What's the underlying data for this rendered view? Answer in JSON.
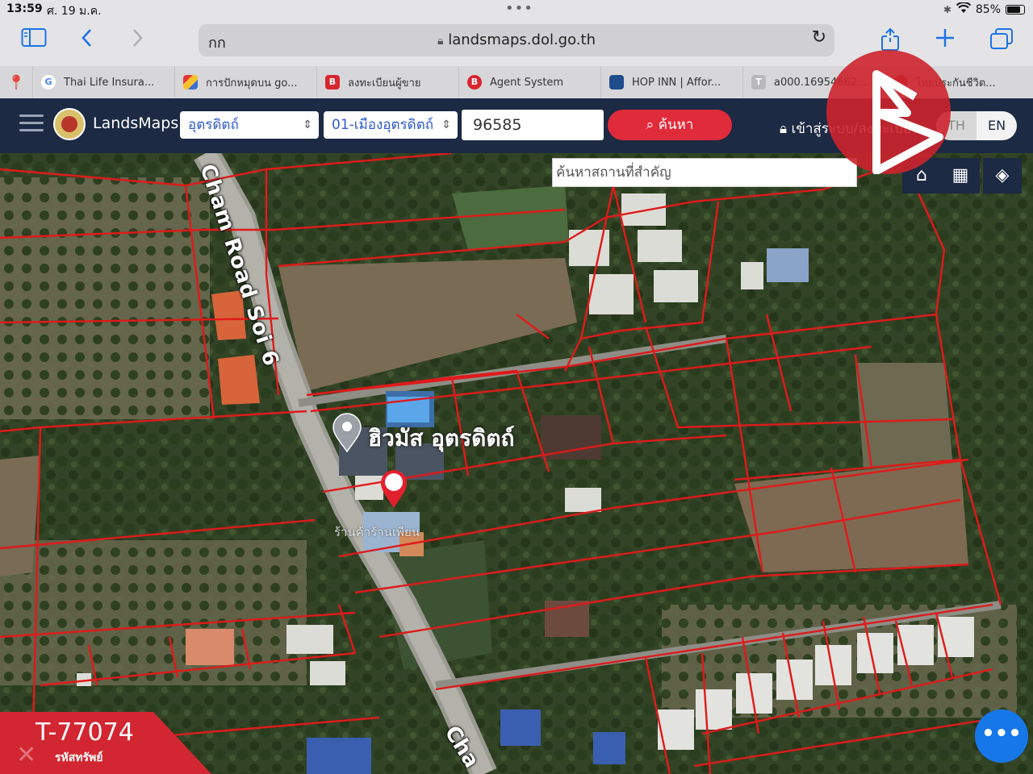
{
  "status_bar": {
    "time": "13:59",
    "date": "ศ. 19 ม.ค.",
    "battery": "85%"
  },
  "browser": {
    "reader_label": "กก",
    "url": "landsmaps.dol.go.th",
    "tabs": [
      {
        "label": "Thai Life Insura...",
        "favicon_color": "#ffffff",
        "favicon_text": "G"
      },
      {
        "label": "การปักหมุดบน go...",
        "favicon_color": "#3b6fd8",
        "favicon_text": ""
      },
      {
        "label": "ลงทะเบียนผู้ขาย",
        "favicon_color": "#d7262e",
        "favicon_text": "B"
      },
      {
        "label": "Agent System",
        "favicon_color": "#d7262e",
        "favicon_text": "B"
      },
      {
        "label": "HOP INN | Affor...",
        "favicon_color": "#1f4d8c",
        "favicon_text": ""
      },
      {
        "label": "a000.16954662...",
        "favicon_color": "#b9b9bd",
        "favicon_text": "T"
      },
      {
        "label": "ไทยประกันชีวิต...",
        "favicon_color": "#c7334a",
        "favicon_text": ""
      }
    ]
  },
  "landsmaps": {
    "brand": "LandsMaps",
    "province": "อุตรดิตถ์",
    "district": "01-เมืองอุตรดิตถ์",
    "parcel_number": "96585",
    "search_label": "ค้นหา",
    "login_label": "เข้าสู่ระบบ/ลงทะเบียน",
    "lang_th": "TH",
    "lang_en": "EN",
    "place_search_placeholder": "ค้นหาสถานที่สำคัญ"
  },
  "map": {
    "road_label": "Cham Road Soi 6",
    "road_label_bottom": "Cha",
    "poi_name": "ฮิวมัส อุตรดิตถ์",
    "poi_secondary": "ร้านค้าร้านเพียน"
  },
  "listing": {
    "code": "T-77074",
    "code_caption": "รหัสทรัพย์"
  }
}
